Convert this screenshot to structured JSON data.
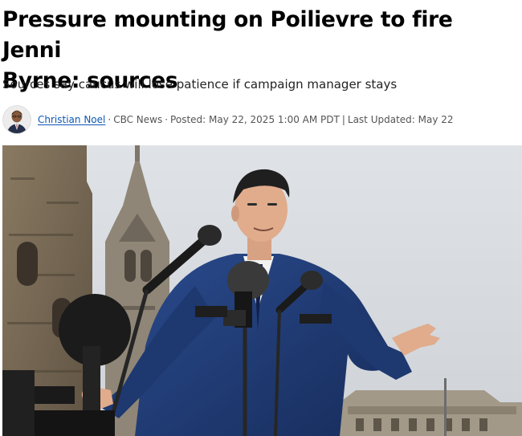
{
  "article": {
    "headline_line1": "Pressure mounting on Poilievre to fire Jenni",
    "headline_line2": "Byrne: sources",
    "deck": "Sources say caucus will lose patience if campaign manager stays",
    "byline": {
      "author": "Christian Noel",
      "separator": "·",
      "outlet": "CBC News",
      "posted": "Posted: May 22, 2025 1:00 AM PDT",
      "divider": "|",
      "updated": "Last Updated: May 22"
    }
  },
  "colors": {
    "author_link": "#0c57b3",
    "suit": "#1f3a73",
    "sky": "#d7dbe0"
  },
  "icons": {
    "avatar": "author-avatar"
  }
}
